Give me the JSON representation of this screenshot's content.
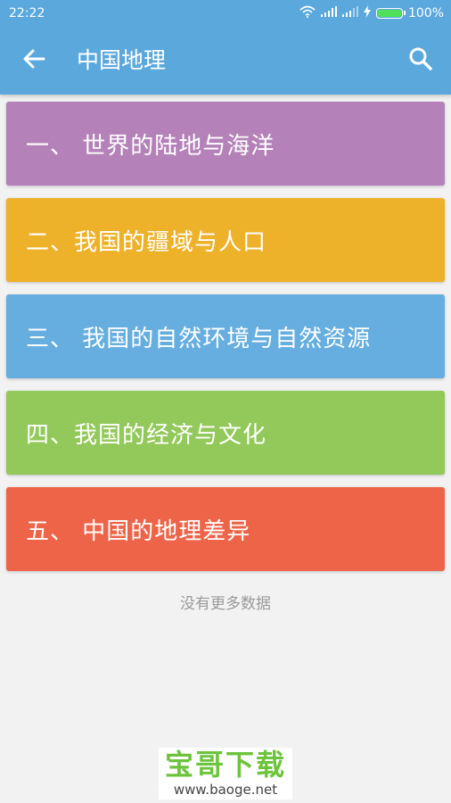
{
  "status": {
    "time": "22:22",
    "battery": "100%",
    "battery_level": 1.0
  },
  "appbar": {
    "back_icon": "arrow-left-icon",
    "title": "中国地理",
    "search_icon": "search-icon",
    "color": "#5ba8dd"
  },
  "chapters": [
    {
      "label": "一、 世界的陆地与海洋",
      "color": "#b482b8"
    },
    {
      "label": "二、我国的疆域与人口",
      "color": "#eeb12a"
    },
    {
      "label": "三、 我国的自然环境与自然资源",
      "color": "#66aee0"
    },
    {
      "label": "四、我国的经济与文化",
      "color": "#93c95a"
    },
    {
      "label": "五、 中国的地理差异",
      "color": "#ee6448"
    }
  ],
  "footer": {
    "no_more": "没有更多数据"
  },
  "watermark": {
    "title": "宝哥下载",
    "url": "www.baoge.net"
  }
}
